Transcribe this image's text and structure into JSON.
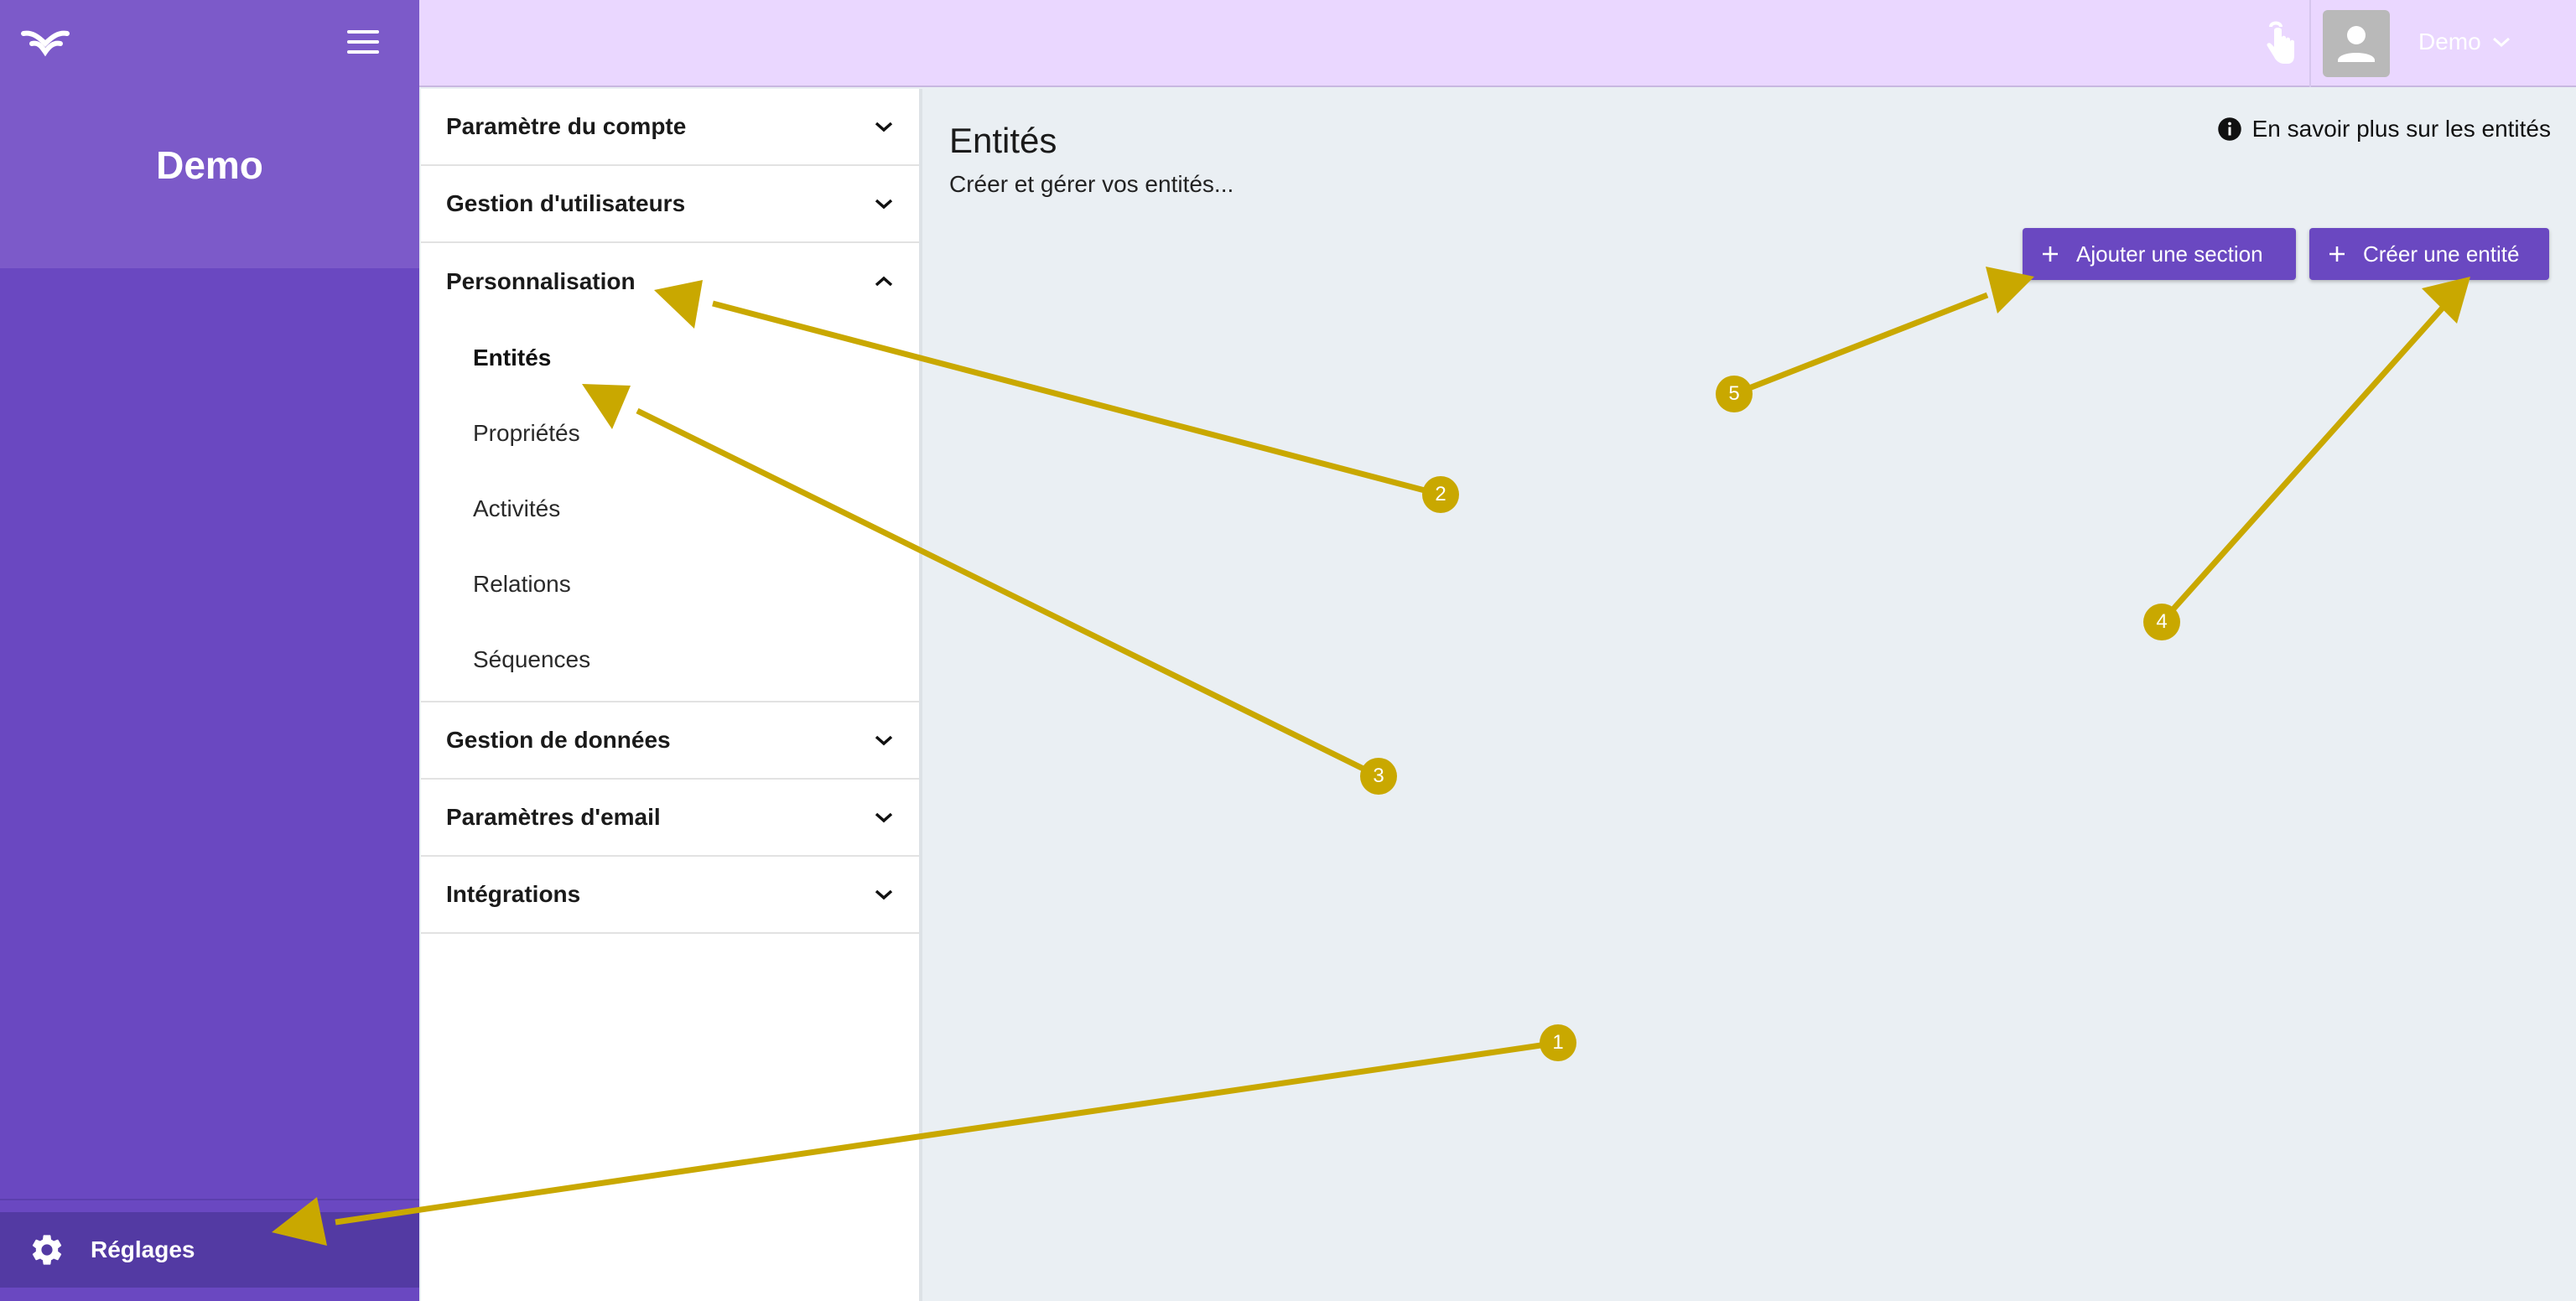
{
  "sidebar": {
    "org_name": "Demo",
    "settings_label": "Réglages"
  },
  "topbar": {
    "user_name": "Demo"
  },
  "nav": {
    "sections": [
      {
        "label": "Paramètre du compte"
      },
      {
        "label": "Gestion d'utilisateurs"
      },
      {
        "label": "Personnalisation"
      },
      {
        "label": "Gestion de données"
      },
      {
        "label": "Paramètres d'email"
      },
      {
        "label": "Intégrations"
      }
    ],
    "personnalisation_items": [
      {
        "label": "Entités"
      },
      {
        "label": "Propriétés"
      },
      {
        "label": "Activités"
      },
      {
        "label": "Relations"
      },
      {
        "label": "Séquences"
      }
    ]
  },
  "main": {
    "title": "Entités",
    "subtitle": "Créer et gérer vos entités...",
    "learn_more": "En savoir plus sur les entités",
    "add_section_label": "Ajouter une section",
    "create_entity_label": "Créer une entité"
  },
  "annotations": [
    "1",
    "2",
    "3",
    "4",
    "5"
  ],
  "colors": {
    "primary": "#6a48c1",
    "sidebar_top": "#7c5ac9",
    "topbar": "#ead7ff",
    "content_bg": "#eaeff3",
    "annotation": "#c9a800"
  }
}
